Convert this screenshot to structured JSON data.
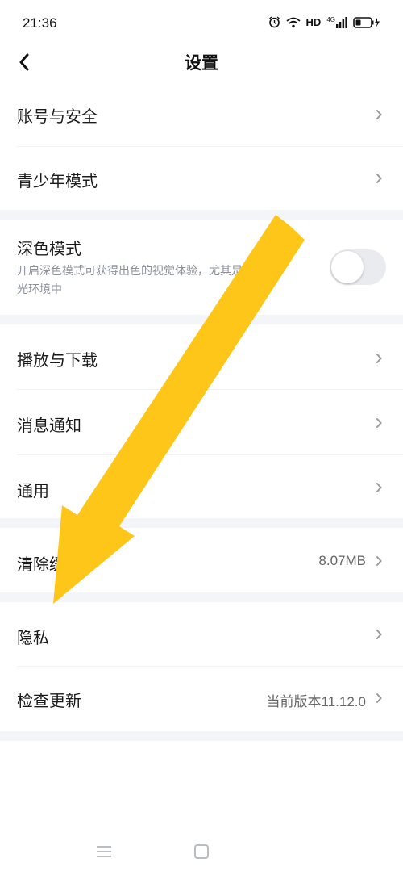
{
  "status_bar": {
    "time": "21:36",
    "network": "HD",
    "signal_label": "4G"
  },
  "header": {
    "title": "设置",
    "back_icon": "back-arrow-icon"
  },
  "settings": {
    "account_security": "账号与安全",
    "teen_mode": "青少年模式",
    "dark_mode": {
      "label": "深色模式",
      "description_line1": "开启深色模式可获得出色的视觉体验，尤其是在弱",
      "description_line2": "光环境中",
      "enabled": false
    },
    "playback_download": "播放与下载",
    "notifications": "消息通知",
    "general": "通用",
    "clear_cache": {
      "label": "清除缓存",
      "value": "8.07MB"
    },
    "privacy": "隐私",
    "check_update": {
      "label": "检查更新",
      "value": "当前版本11.12.0"
    }
  },
  "annotation": {
    "arrow_color": "#FFC61A"
  },
  "colors": {
    "section_gap": "#f3f5f8",
    "chevron": "#999999"
  }
}
